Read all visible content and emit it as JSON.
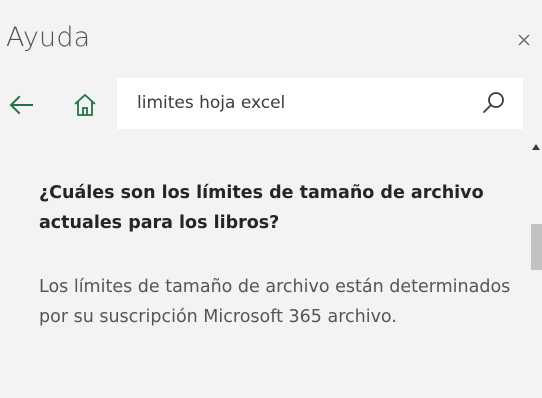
{
  "pane": {
    "title": "Ayuda",
    "close_icon": "close-icon"
  },
  "nav": {
    "back_icon": "arrow-left-icon",
    "home_icon": "home-icon",
    "accent_color": "#217346"
  },
  "search": {
    "value": "limites hoja excel",
    "icon": "search-icon"
  },
  "article": {
    "question": "¿Cuáles son los límites de tamaño de archivo actuales para los libros?",
    "answer": "Los límites de tamaño de archivo están determinados por su suscripción Microsoft 365 archivo."
  },
  "scrollbar": {
    "up_icon": "scroll-up-arrow-icon",
    "thumb_color": "#c2c2c2"
  }
}
